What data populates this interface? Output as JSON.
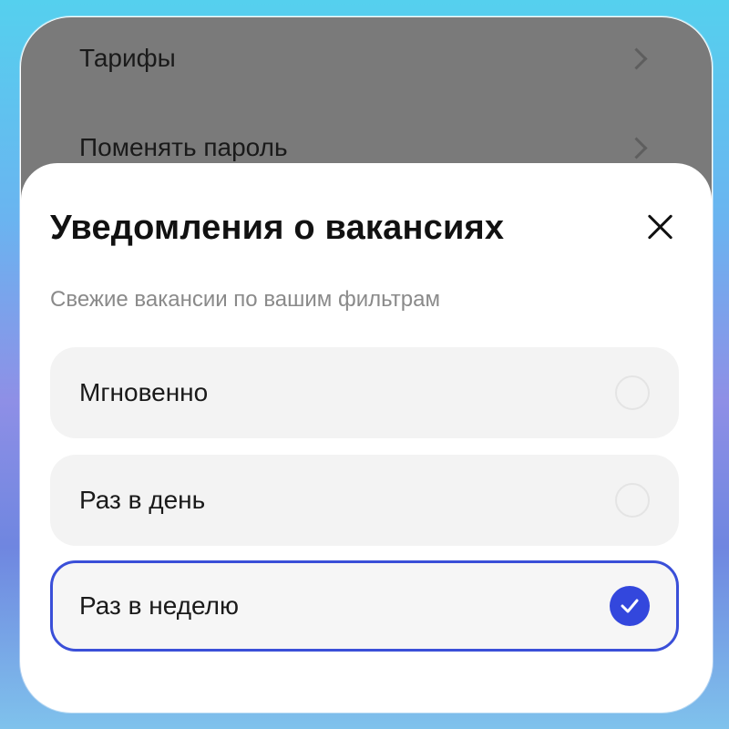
{
  "background_screen": {
    "items": [
      {
        "label": "Тарифы"
      },
      {
        "label": "Поменять пароль"
      }
    ]
  },
  "sheet": {
    "title": "Уведомления о вакансиях",
    "subtitle": "Свежие вакансии по вашим фильтрам",
    "options": [
      {
        "label": "Мгновенно",
        "selected": false
      },
      {
        "label": "Раз в день",
        "selected": false
      },
      {
        "label": "Раз в неделю",
        "selected": true
      }
    ]
  },
  "colors": {
    "accent": "#3347dd",
    "selected_border": "#3a4fd8",
    "option_bg": "#f3f3f3",
    "overlay": "#7a7a7a"
  },
  "icons": {
    "close": "close-icon",
    "chevron": "chevron-right-icon",
    "check": "check-icon"
  }
}
